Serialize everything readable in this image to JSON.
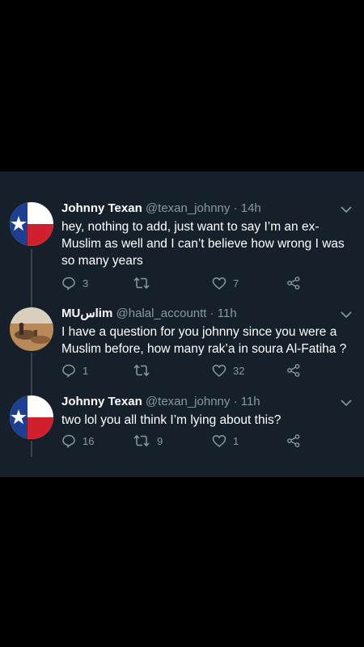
{
  "tweets": [
    {
      "name": "Johnny Texan",
      "handle": "@texan_johnny",
      "time": "· 14h",
      "text": "hey, nothing to add, just want to say I’m an ex-Muslim as well and I can’t believe how wrong I was so many years",
      "replies": "3",
      "retweets": "",
      "likes": "7",
      "avatar": "texas-flag"
    },
    {
      "name": "MUسlim",
      "handle": "@halal_accountt",
      "time": "· 11h",
      "text": "I have a question for you johnny since you were a Muslim before, how many rak’a in soura Al-Fatiha ?",
      "replies": "1",
      "retweets": "",
      "likes": "32",
      "avatar": "desert-photo"
    },
    {
      "name": "Johnny Texan",
      "handle": "@texan_johnny",
      "time": "· 11h",
      "text": "two lol you all think I’m lying about this?",
      "replies": "16",
      "retweets": "9",
      "likes": "1",
      "avatar": "texas-flag"
    }
  ],
  "icons": {
    "reply": "reply-icon",
    "retweet": "retweet-icon",
    "like": "heart-icon",
    "share": "share-icon",
    "caret": "chevron-down-icon"
  },
  "colors": {
    "background": "#15202b",
    "text": "#ffffff",
    "secondary": "#8899a6",
    "flag_blue": "#1c3f94",
    "flag_red": "#d0202e"
  }
}
